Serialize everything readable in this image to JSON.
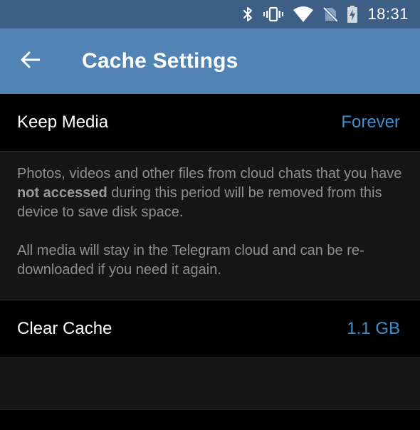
{
  "status_bar": {
    "time": "18:31",
    "icons": [
      "bluetooth-icon",
      "vibrate-icon",
      "wifi-icon",
      "no-sim-icon",
      "battery-charging-icon"
    ]
  },
  "app_bar": {
    "back_icon": "arrow-left-icon",
    "title": "Cache Settings"
  },
  "keep_media": {
    "label": "Keep Media",
    "value": "Forever"
  },
  "info": {
    "para1_before": "Photos, videos and other files from cloud chats that you have ",
    "para1_bold": "not accessed",
    "para1_after": " during this period will be removed from this device to save disk space.",
    "para2": "All media will stay in the Telegram cloud and can be re-downloaded if you need it again."
  },
  "clear_cache": {
    "label": "Clear Cache",
    "value": "1.1 GB"
  },
  "colors": {
    "status_bar": "#3d5f85",
    "app_bar": "#5183b4",
    "accent_value": "#3c8fcf",
    "background": "#000000",
    "info_background": "#161616",
    "info_text": "#8f8f8f"
  }
}
